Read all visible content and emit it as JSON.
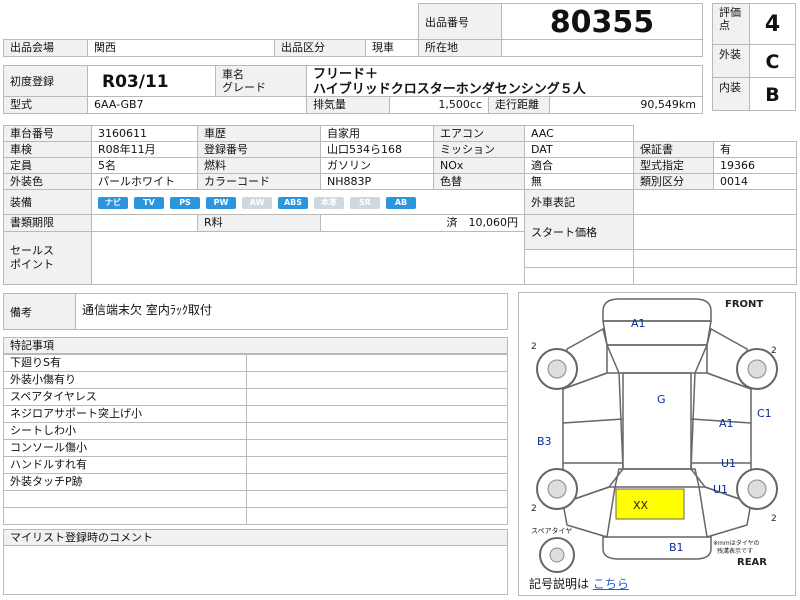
{
  "header": {
    "lot_no_label": "出品番号",
    "lot_no": "80355",
    "venue_label": "出品会場",
    "venue": "関西",
    "category_label": "出品区分",
    "category": "現車",
    "location_label": "所在地",
    "location": ""
  },
  "scores": {
    "overall_label": "評価点",
    "overall": "4",
    "exterior_label": "外装",
    "exterior": "C",
    "interior_label": "内装",
    "interior": "B"
  },
  "vehicle": {
    "first_reg_label": "初度登録",
    "first_reg": "R03/11",
    "name_label": "車名",
    "grade_label": "グレード",
    "name_line1": "フリード＋",
    "name_line2": "ハイブリッドクロスターホンダセンシング５人",
    "model_label": "型式",
    "model": "6AA-GB7",
    "displacement_label": "排気量",
    "displacement": "1,500cc",
    "mileage_label": "走行距離",
    "mileage": "90,549km"
  },
  "specs": {
    "chassis_label": "車台番号",
    "chassis": "3160611",
    "history_label": "車歴",
    "history": "自家用",
    "ac_label": "エアコン",
    "ac": "AAC",
    "inspection_label": "車検",
    "inspection": "R08年11月",
    "plate_label": "登録番号",
    "plate": "山口534ら168",
    "mission_label": "ミッション",
    "mission": "DAT",
    "warranty_label": "保証書",
    "warranty": "有",
    "capacity_label": "定員",
    "capacity": "5名",
    "fuel_label": "燃料",
    "fuel": "ガソリン",
    "nox_label": "NOx",
    "nox": "適合",
    "type_cert_label": "型式指定",
    "type_cert": "19366",
    "color_label": "外装色",
    "color": "パールホワイト",
    "color_code_label": "カラーコード",
    "color_code": "NH883P",
    "recolor_label": "色替",
    "recolor": "無",
    "class_label": "類別区分",
    "class": "0014",
    "equipment_label": "装備",
    "import_label": "外車表記",
    "docs_label": "書類期限",
    "recycle_label": "R料",
    "recycle_value": "済　10,060円",
    "start_price_label": "スタート価格",
    "sales_point_label1": "セールス",
    "sales_point_label2": "ポイント"
  },
  "equipment": [
    {
      "label": "ナビ",
      "on": true
    },
    {
      "label": "TV",
      "on": true
    },
    {
      "label": "PS",
      "on": true
    },
    {
      "label": "PW",
      "on": true
    },
    {
      "label": "AW",
      "on": false
    },
    {
      "label": "ABS",
      "on": true
    },
    {
      "label": "本革",
      "on": false
    },
    {
      "label": "SR",
      "on": false
    },
    {
      "label": "AB",
      "on": true
    }
  ],
  "remarks": {
    "label": "備考",
    "text": "通信端末欠 室内ﾗｯｸ取付"
  },
  "special_notes": {
    "label": "特記事項",
    "items": [
      "下廻りS有",
      "外装小傷有り",
      "スペアタイヤレス",
      "ネジロアサポート突上げ小",
      "シートしわ小",
      "コンソール傷小",
      "ハンドルすれ有",
      "外装タッチP跡",
      "",
      ""
    ]
  },
  "mylist": {
    "label": "マイリスト登録時のコメント"
  },
  "diagram": {
    "front": "FRONT",
    "rear": "REAR",
    "spare": "スペアタイヤ",
    "note_line1": "※mmはタイヤの",
    "note_line2": "残溝表示です",
    "tire_fl": "2",
    "tire_fr": "2",
    "tire_rl": "2",
    "tire_rr": "2",
    "marks": {
      "a1_front": "A1",
      "g": "G",
      "a1_right": "A1",
      "c1": "C1",
      "u1_right": "U1",
      "u1_rear": "U1",
      "b3": "B3",
      "xx": "XX",
      "b1": "B1"
    },
    "legend_label": "記号説明は",
    "legend_link": "こちら"
  },
  "colors": {
    "accent": "#2b96dd",
    "highlight": "#ffff00",
    "label_bg": "#f1f1f1"
  }
}
